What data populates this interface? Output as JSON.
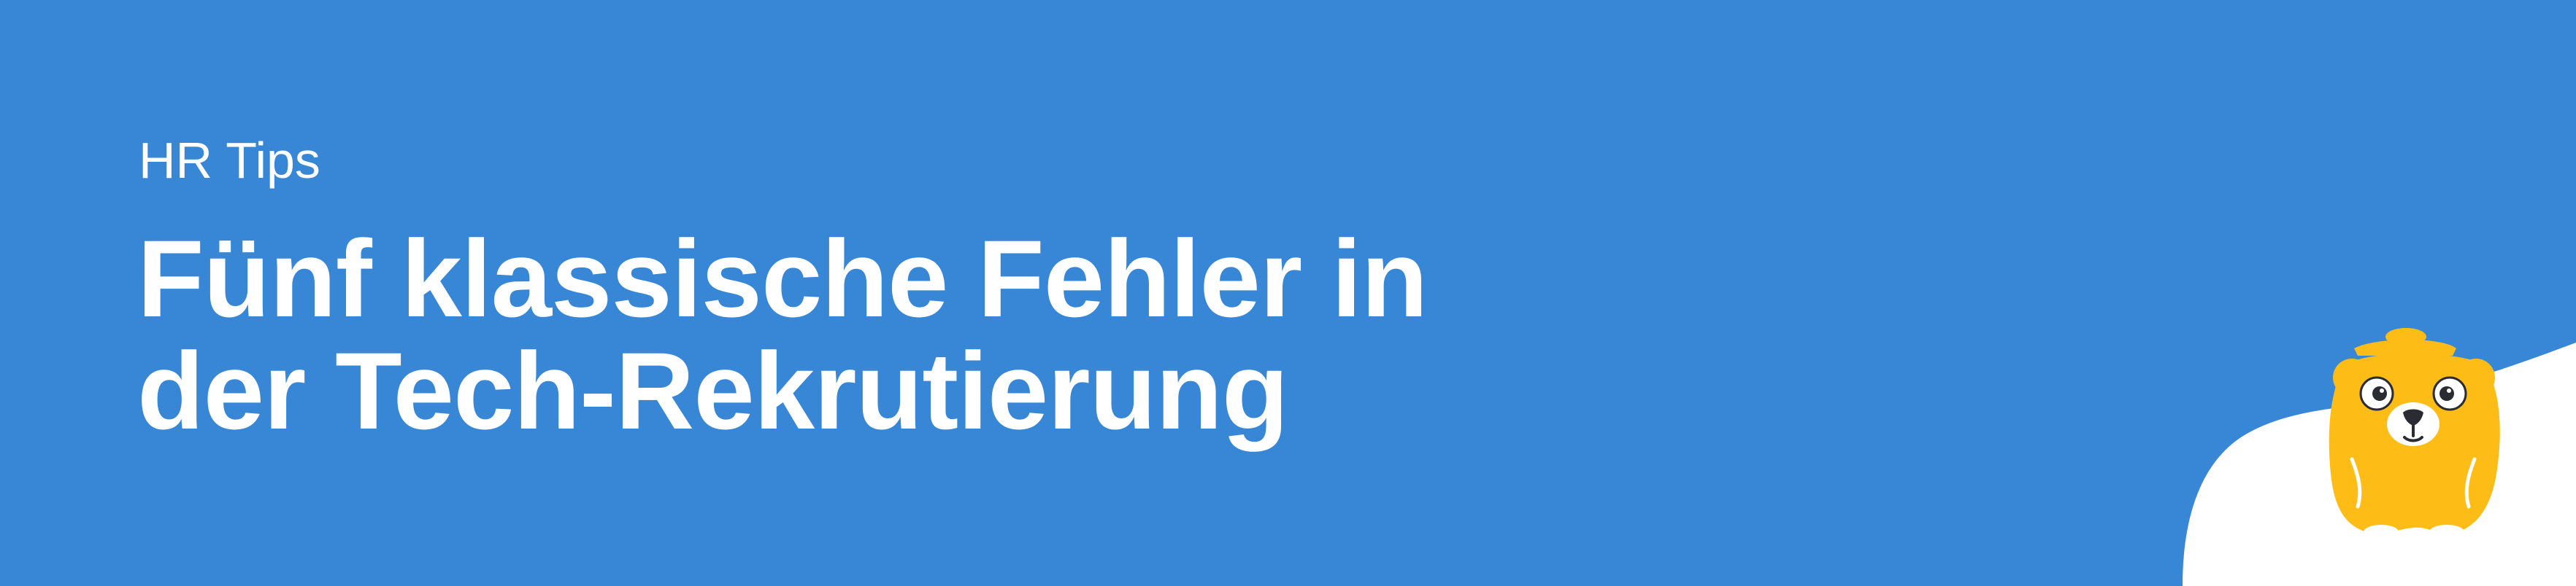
{
  "banner": {
    "kicker": "HR Tips",
    "headline_line_1": "Fünf klassische Fehler in",
    "headline_line_2": "der Tech-Rekrutierung"
  },
  "colors": {
    "background": "#3887d7",
    "text": "#ffffff",
    "wave": "#ffffff",
    "mascot_body": "#fdbd16"
  },
  "mascot": {
    "icon": "yellow-bear-mascot-icon"
  }
}
